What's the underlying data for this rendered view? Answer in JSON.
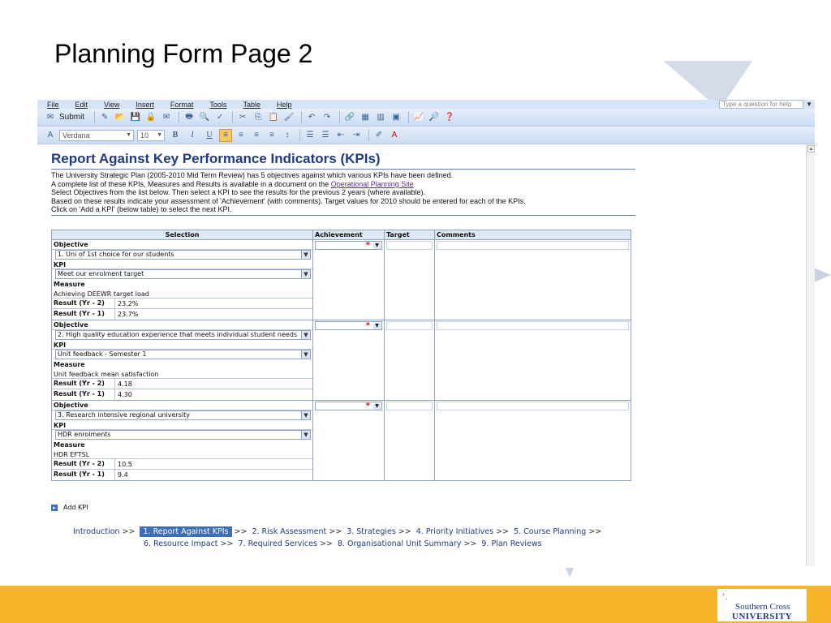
{
  "slide": {
    "title": "Planning Form Page 2"
  },
  "menu": {
    "items": [
      "File",
      "Edit",
      "View",
      "Insert",
      "Format",
      "Tools",
      "Table",
      "Help"
    ],
    "help_placeholder": "Type a question for help"
  },
  "toolbar": {
    "submit_label": "Submit",
    "font_name": "Verdana",
    "font_size": "10"
  },
  "doc": {
    "title": "Report Against Key Performance Indicators (KPIs)",
    "intro": [
      "The University Strategic Plan (2005-2010 Mid Term Review) has 5 objectives against which various KPIs have been defined.",
      "A complete list of these KPIs, Measures and Results is available in a document on the ",
      "Select Objectives from the list below. Then select a KPI to see the results for the previous 2 years (where available).",
      "Based on these results indicate your assessment of 'Achievement' (with comments). Target values for 2010 should be entered for each of the KPIs.",
      "Click on 'Add a KPI' (below table) to select the next KPI."
    ],
    "intro_link": "Operational Planning Site"
  },
  "table": {
    "headers": [
      "Selection",
      "Achievement",
      "Target",
      "Comments"
    ],
    "labels": {
      "objective": "Objective",
      "kpi": "KPI",
      "measure": "Measure",
      "yr2": "Result (Yr - 2)",
      "yr1": "Result (Yr - 1)"
    },
    "rows": [
      {
        "objective": "1. Uni of 1st choice for our students",
        "kpi": "Meet our enrolment target",
        "measure": "Achieving DEEWR target load",
        "yr2": "23.2%",
        "yr1": "23.7%"
      },
      {
        "objective": "2. High quality education experience that meets individual student needs",
        "kpi": "Unit feedback - Semester 1",
        "measure": "Unit feedback mean satisfaction",
        "yr2": "4.18",
        "yr1": "4.30"
      },
      {
        "objective": "3. Research intensive regional university",
        "kpi": "HDR enrolments",
        "measure": "HDR EFTSL",
        "yr2": "10.5",
        "yr1": "9.4"
      }
    ],
    "required_mark": "*",
    "add_kpi": "Add KPI"
  },
  "nav": {
    "line1": [
      "Introduction",
      "1. Report Against KPIs",
      "2. Risk Assessment",
      "3. Strategies",
      "4. Priority Initiatives",
      "5. Course Planning"
    ],
    "line2": [
      "6. Resource Impact",
      "7. Required Services",
      "8. Organisational Unit Summary",
      "9. Plan Reviews"
    ],
    "sep": ">>"
  },
  "footer": {
    "logo_line1": "Southern Cross",
    "logo_line2": "UNIVERSITY"
  },
  "colors": {
    "accent": "#1f3c80",
    "footer": "#f6b42a",
    "active_nav": "#3d6fb6"
  }
}
